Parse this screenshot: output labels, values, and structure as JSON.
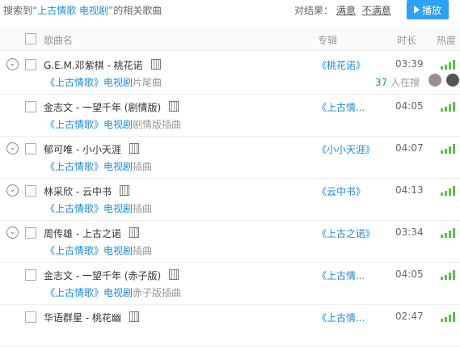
{
  "search_header": {
    "prefix": "搜索到",
    "query": "“上古情歌 电视剧”",
    "suffix": "的相关歌曲"
  },
  "feedback": {
    "label": "对结果：",
    "good": "满意",
    "bad": "不满意"
  },
  "play_button": {
    "label": "播放"
  },
  "columns": {
    "name": "歌曲名",
    "album": "专辑",
    "duration": "时长",
    "hot": "热度"
  },
  "songs": [
    {
      "title": "G.E.M.邓紫棋 - 桃花诺",
      "sub_hl": "《上古情歌》电视剧",
      "sub_tail": "片尾曲",
      "album": "《桃花诺》",
      "duration": "03:39",
      "searching": "37",
      "searching_label": "人在搜"
    },
    {
      "title": "金志文 - 一望千年 (剧情版)",
      "sub_hl": "《上古情歌》电视剧",
      "sub_tail": "剧情版插曲",
      "album": "《上古情...",
      "duration": "04:05"
    },
    {
      "title": "郁可唯 - 小小天涯",
      "sub_hl": "《上古情歌》电视剧",
      "sub_tail": "插曲",
      "album": "《小小天涯》",
      "duration": "04:07"
    },
    {
      "title": "林采欣 - 云中书",
      "sub_hl": "《上古情歌》电视剧",
      "sub_tail": "插曲",
      "album": "《云中书》",
      "duration": "04:13"
    },
    {
      "title": "周传雄 - 上古之诺",
      "sub_hl": "《上古情歌》电视剧",
      "sub_tail": "插曲",
      "album": "《上古之诺》",
      "duration": "03:34"
    },
    {
      "title": "金志文 - 一望千年 (赤子版)",
      "sub_hl": "《上古情歌》电视剧",
      "sub_tail": "赤子版插曲",
      "album": "《上古情...",
      "duration": "04:05"
    },
    {
      "title": "华语群星 - 桃花幽",
      "sub_hl": "",
      "sub_tail": "",
      "album": "《上古情...",
      "duration": "02:47"
    }
  ]
}
